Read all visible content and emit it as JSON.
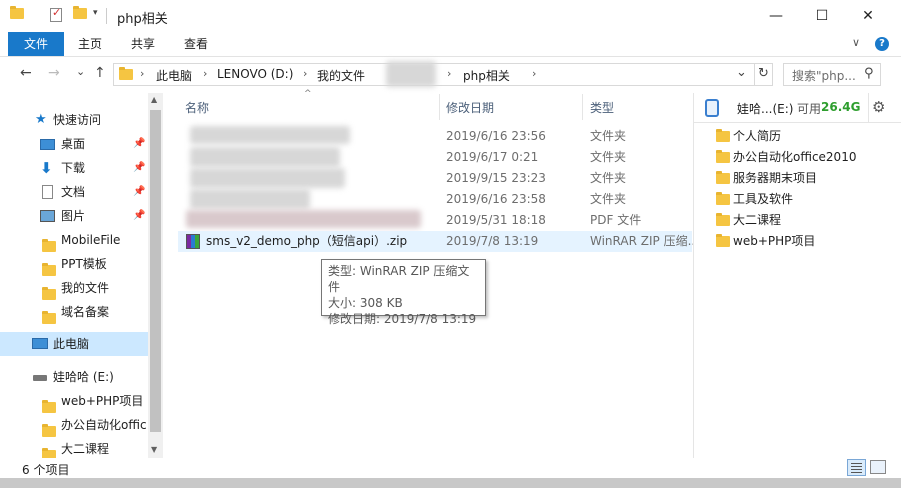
{
  "window": {
    "title": "php相关",
    "minimize": "—",
    "maximize": "☐",
    "close": "✕"
  },
  "ribbon": {
    "tabs": [
      "文件",
      "主页",
      "共享",
      "查看"
    ],
    "collapse": "∨",
    "help": "?"
  },
  "address": {
    "crumbs": [
      "此电脑",
      "LENOVO (D:)",
      "我的文件",
      "php相关"
    ],
    "dropdown": "⌄",
    "refresh": "↻",
    "search_placeholder": "搜索\"php..."
  },
  "nav": {
    "back": "←",
    "forward": "→",
    "recent": "⌄",
    "up": "↑"
  },
  "sidebar": {
    "items": [
      {
        "label": "快速访问",
        "pinned": false
      },
      {
        "label": "桌面",
        "pinned": true
      },
      {
        "label": "下载",
        "pinned": true
      },
      {
        "label": "文档",
        "pinned": true
      },
      {
        "label": "图片",
        "pinned": true
      },
      {
        "label": "MobileFile",
        "pinned": false
      },
      {
        "label": "PPT模板",
        "pinned": false
      },
      {
        "label": "我的文件",
        "pinned": false
      },
      {
        "label": "域名备案",
        "pinned": false
      },
      {
        "label": "此电脑",
        "pinned": false
      },
      {
        "label": "娃哈哈 (E:)",
        "pinned": false
      },
      {
        "label": "web+PHP项目",
        "pinned": false
      },
      {
        "label": "办公自动化offic",
        "pinned": false
      },
      {
        "label": "大二课程",
        "pinned": false
      }
    ]
  },
  "filelist": {
    "columns": {
      "name": "名称",
      "date": "修改日期",
      "type": "类型"
    },
    "rows": [
      {
        "name": "",
        "date": "2019/6/16 23:56",
        "type": "文件夹"
      },
      {
        "name": "",
        "date": "2019/6/17 0:21",
        "type": "文件夹"
      },
      {
        "name": "",
        "date": "2019/9/15 23:23",
        "type": "文件夹"
      },
      {
        "name": "",
        "date": "2019/6/16 23:58",
        "type": "文件夹"
      },
      {
        "name": "",
        "date": "2019/5/31 18:18",
        "type": "PDF 文件"
      },
      {
        "name": "sms_v2_demo_php（短信api）.zip",
        "date": "2019/7/8 13:19",
        "type": "WinRAR ZIP 压缩..."
      }
    ]
  },
  "tooltip": {
    "type": "类型: WinRAR ZIP 压缩文件",
    "size": "大小: 308 KB",
    "date": "修改日期: 2019/7/8 13:19"
  },
  "rightpane": {
    "drive": "娃哈...(E:)",
    "free_label": "可用",
    "free_value": "26.4G",
    "free_color": "#2e9e2e",
    "folders": [
      "个人简历",
      "办公自动化office2010",
      "服务器期末项目",
      "工具及软件",
      "大二课程",
      "web+PHP项目"
    ],
    "expand": "›"
  },
  "status": {
    "count": "6 个项目"
  }
}
